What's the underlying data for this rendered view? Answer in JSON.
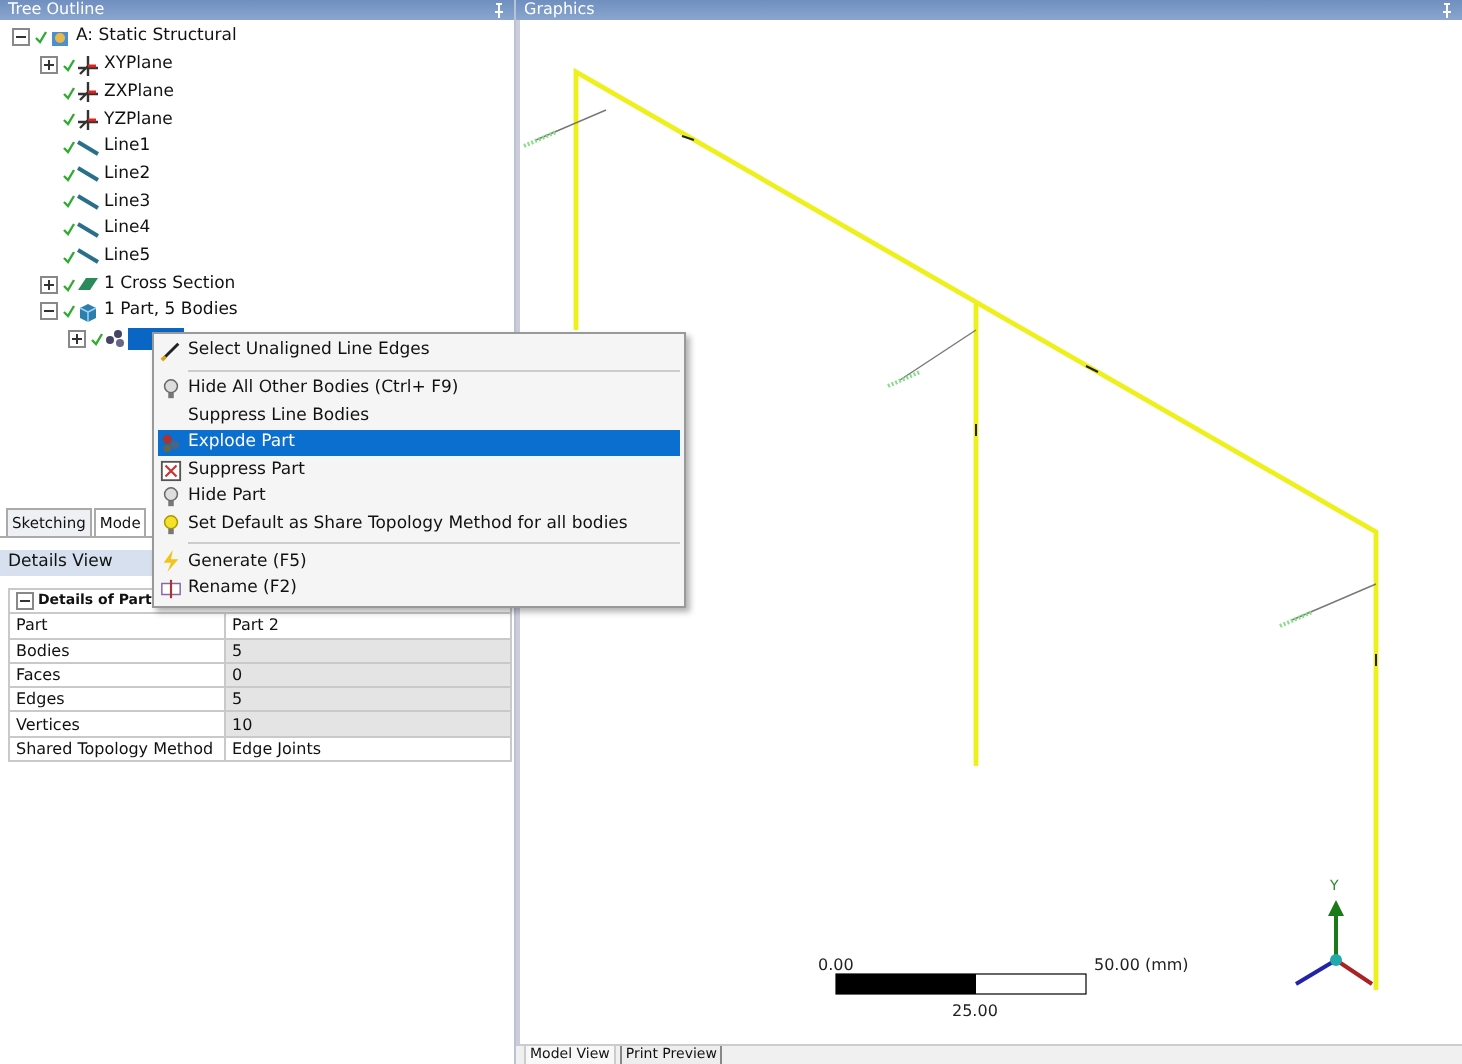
{
  "tree_outline": {
    "title": "Tree Outline",
    "nodes": [
      {
        "label": "A: Static Structural",
        "kind": "root",
        "expanded": true,
        "children": [
          {
            "label": "XYPlane",
            "kind": "plane",
            "expanded": false
          },
          {
            "label": "ZXPlane",
            "kind": "plane"
          },
          {
            "label": "YZPlane",
            "kind": "plane"
          },
          {
            "label": "Line1",
            "kind": "line"
          },
          {
            "label": "Line2",
            "kind": "line"
          },
          {
            "label": "Line3",
            "kind": "line"
          },
          {
            "label": "Line4",
            "kind": "line"
          },
          {
            "label": "Line5",
            "kind": "line"
          },
          {
            "label": "1 Cross Section",
            "kind": "section",
            "expanded": false
          },
          {
            "label": "1 Part, 5 Bodies",
            "kind": "part",
            "expanded": true,
            "children": [
              {
                "kind": "body",
                "expanded": false,
                "selected": true
              }
            ]
          }
        ]
      }
    ]
  },
  "mode_tabs": [
    {
      "label": "Sketching",
      "selected": false
    },
    {
      "label": "Mode",
      "selected": true
    }
  ],
  "details_view": {
    "title": "Details View",
    "group": "Details of Part",
    "expanded": true,
    "rows": [
      {
        "name": "Part",
        "value": "Part 2",
        "editable": true
      },
      {
        "name": "Bodies",
        "value": "5",
        "editable": false
      },
      {
        "name": "Faces",
        "value": "0",
        "editable": false
      },
      {
        "name": "Edges",
        "value": "5",
        "editable": false
      },
      {
        "name": "Vertices",
        "value": "10",
        "editable": false
      },
      {
        "name": "Shared Topology Method",
        "value": "Edge Joints",
        "editable": true
      }
    ]
  },
  "context_menu": [
    {
      "kind": "item",
      "label": "Select Unaligned Line Edges",
      "selected": false
    },
    {
      "kind": "separator"
    },
    {
      "kind": "item",
      "label": "Hide All Other Bodies (Ctrl+ F9)",
      "selected": false
    },
    {
      "kind": "item",
      "label": "Suppress Line Bodies",
      "selected": false
    },
    {
      "kind": "item",
      "label": "Explode Part",
      "selected": true
    },
    {
      "kind": "item",
      "label": "Suppress Part",
      "selected": false
    },
    {
      "kind": "item",
      "label": "Hide Part",
      "selected": false
    },
    {
      "kind": "item",
      "label": "Set Default as Share Topology Method for all bodies",
      "selected": false
    },
    {
      "kind": "separator"
    },
    {
      "kind": "item",
      "label": "Generate (F5)",
      "selected": false
    },
    {
      "kind": "item",
      "label": "Rename (F2)",
      "selected": false
    }
  ],
  "graphics": {
    "title": "Graphics",
    "scale": {
      "start": "0.00",
      "mid": "25.00",
      "end": "50.00 (mm)"
    },
    "triad_label": "Y",
    "view_tabs": [
      {
        "label": "Model View",
        "selected": true
      },
      {
        "label": "Print Preview",
        "selected": false
      }
    ]
  }
}
